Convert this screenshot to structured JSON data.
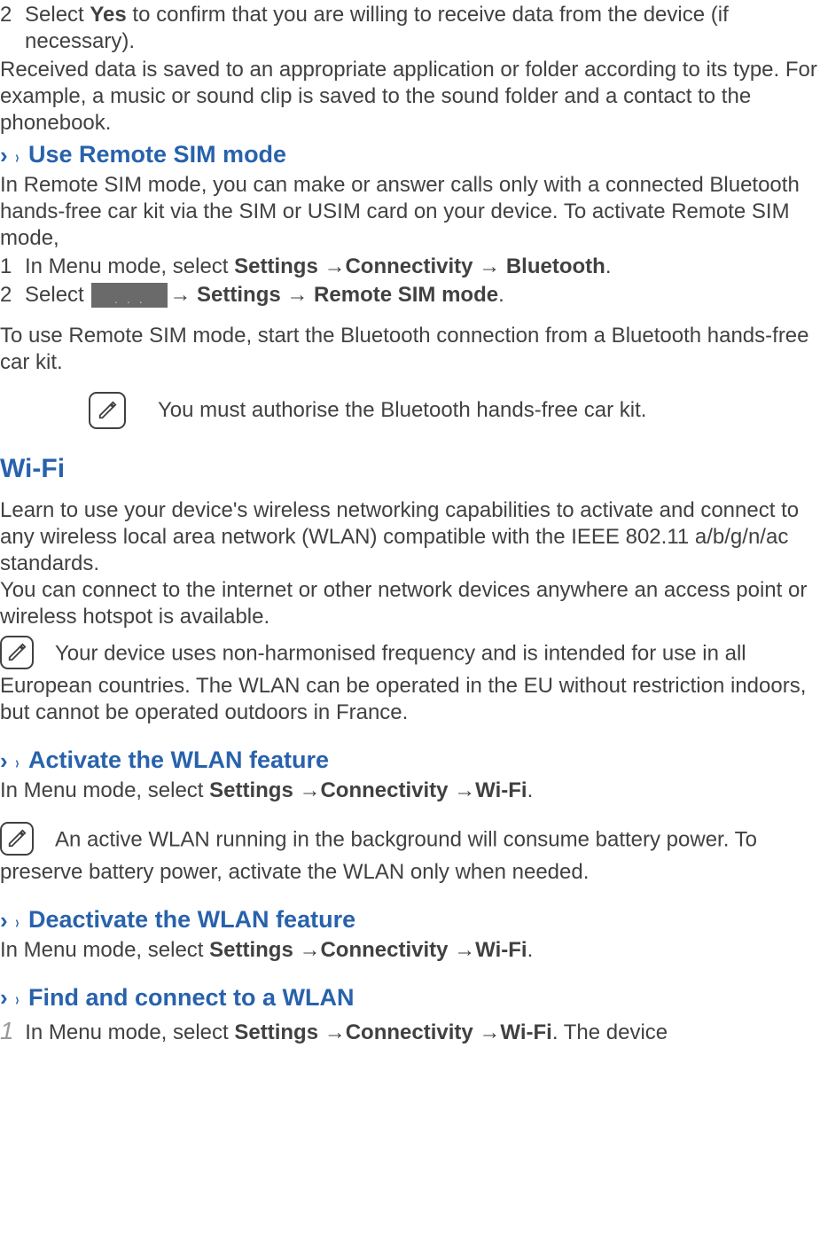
{
  "step2_num": "2",
  "step2_pre": "Select ",
  "step2_bold": "Yes",
  "step2_post": " to confirm that you are willing to receive data from the device (if necessary).",
  "received_para": "Received data is saved to an appropriate application or folder according to its type. For example, a music or sound clip is saved to the sound folder and a contact to the phonebook.",
  "chev": "›",
  "chev_inner": "›",
  "h_remote_sim": "Use Remote SIM mode",
  "remote_sim_para": "In Remote SIM mode, you can make or answer calls only with a connected Bluetooth hands-free car kit via the SIM or USIM card on your device. To activate Remote SIM mode,",
  "rs_s1_num": "1",
  "rs_s1_pre": "In Menu mode, select ",
  "rs_s1_b1": "Settings →Connectivity → Bluetooth",
  "rs_s1_post": ".",
  "rs_s2_num": "2",
  "rs_s2_pre": "Select  ",
  "rs_s2_b1": "→ Settings → Remote SIM mode",
  "rs_s2_post": ".",
  "rs_use_para": "To use Remote SIM mode, start the Bluetooth connection from a Bluetooth hands-free car kit.",
  "note_authorise": "You must authorise the Bluetooth hands-free car kit.",
  "h_wifi": "Wi-Fi",
  "wifi_p1": "Learn to use your device's wireless networking capabilities to activate and connect to any wireless local area network (WLAN) compatible with the IEEE 802.11 a/b/g/n/ac standards.",
  "wifi_p2": "You can connect to the internet or other network devices anywhere an access point or wireless hotspot is available.",
  "note_freq": "Your device uses non-harmonised frequency and is intended for use in all European countries. The WLAN can be operated in the EU without restriction indoors, but cannot be operated outdoors in France.",
  "h_activate": "Activate the WLAN feature",
  "activate_pre": "In Menu mode, select ",
  "activate_b": "Settings →Connectivity →Wi-Fi",
  "activate_post": ".",
  "note_battery": "An active WLAN running in the background will consume battery power. To preserve battery power, activate the WLAN only when needed.",
  "h_deactivate": "Deactivate the WLAN feature",
  "deactivate_pre": "In Menu mode, select ",
  "deactivate_b": "Settings →Connectivity →Wi-Fi",
  "deactivate_post": ".",
  "h_find": "Find and connect to a WLAN",
  "find_num": "1",
  "find_pre": " In Menu mode, select ",
  "find_b": "Settings →Connectivity →Wi-Fi",
  "find_post": ". The device"
}
